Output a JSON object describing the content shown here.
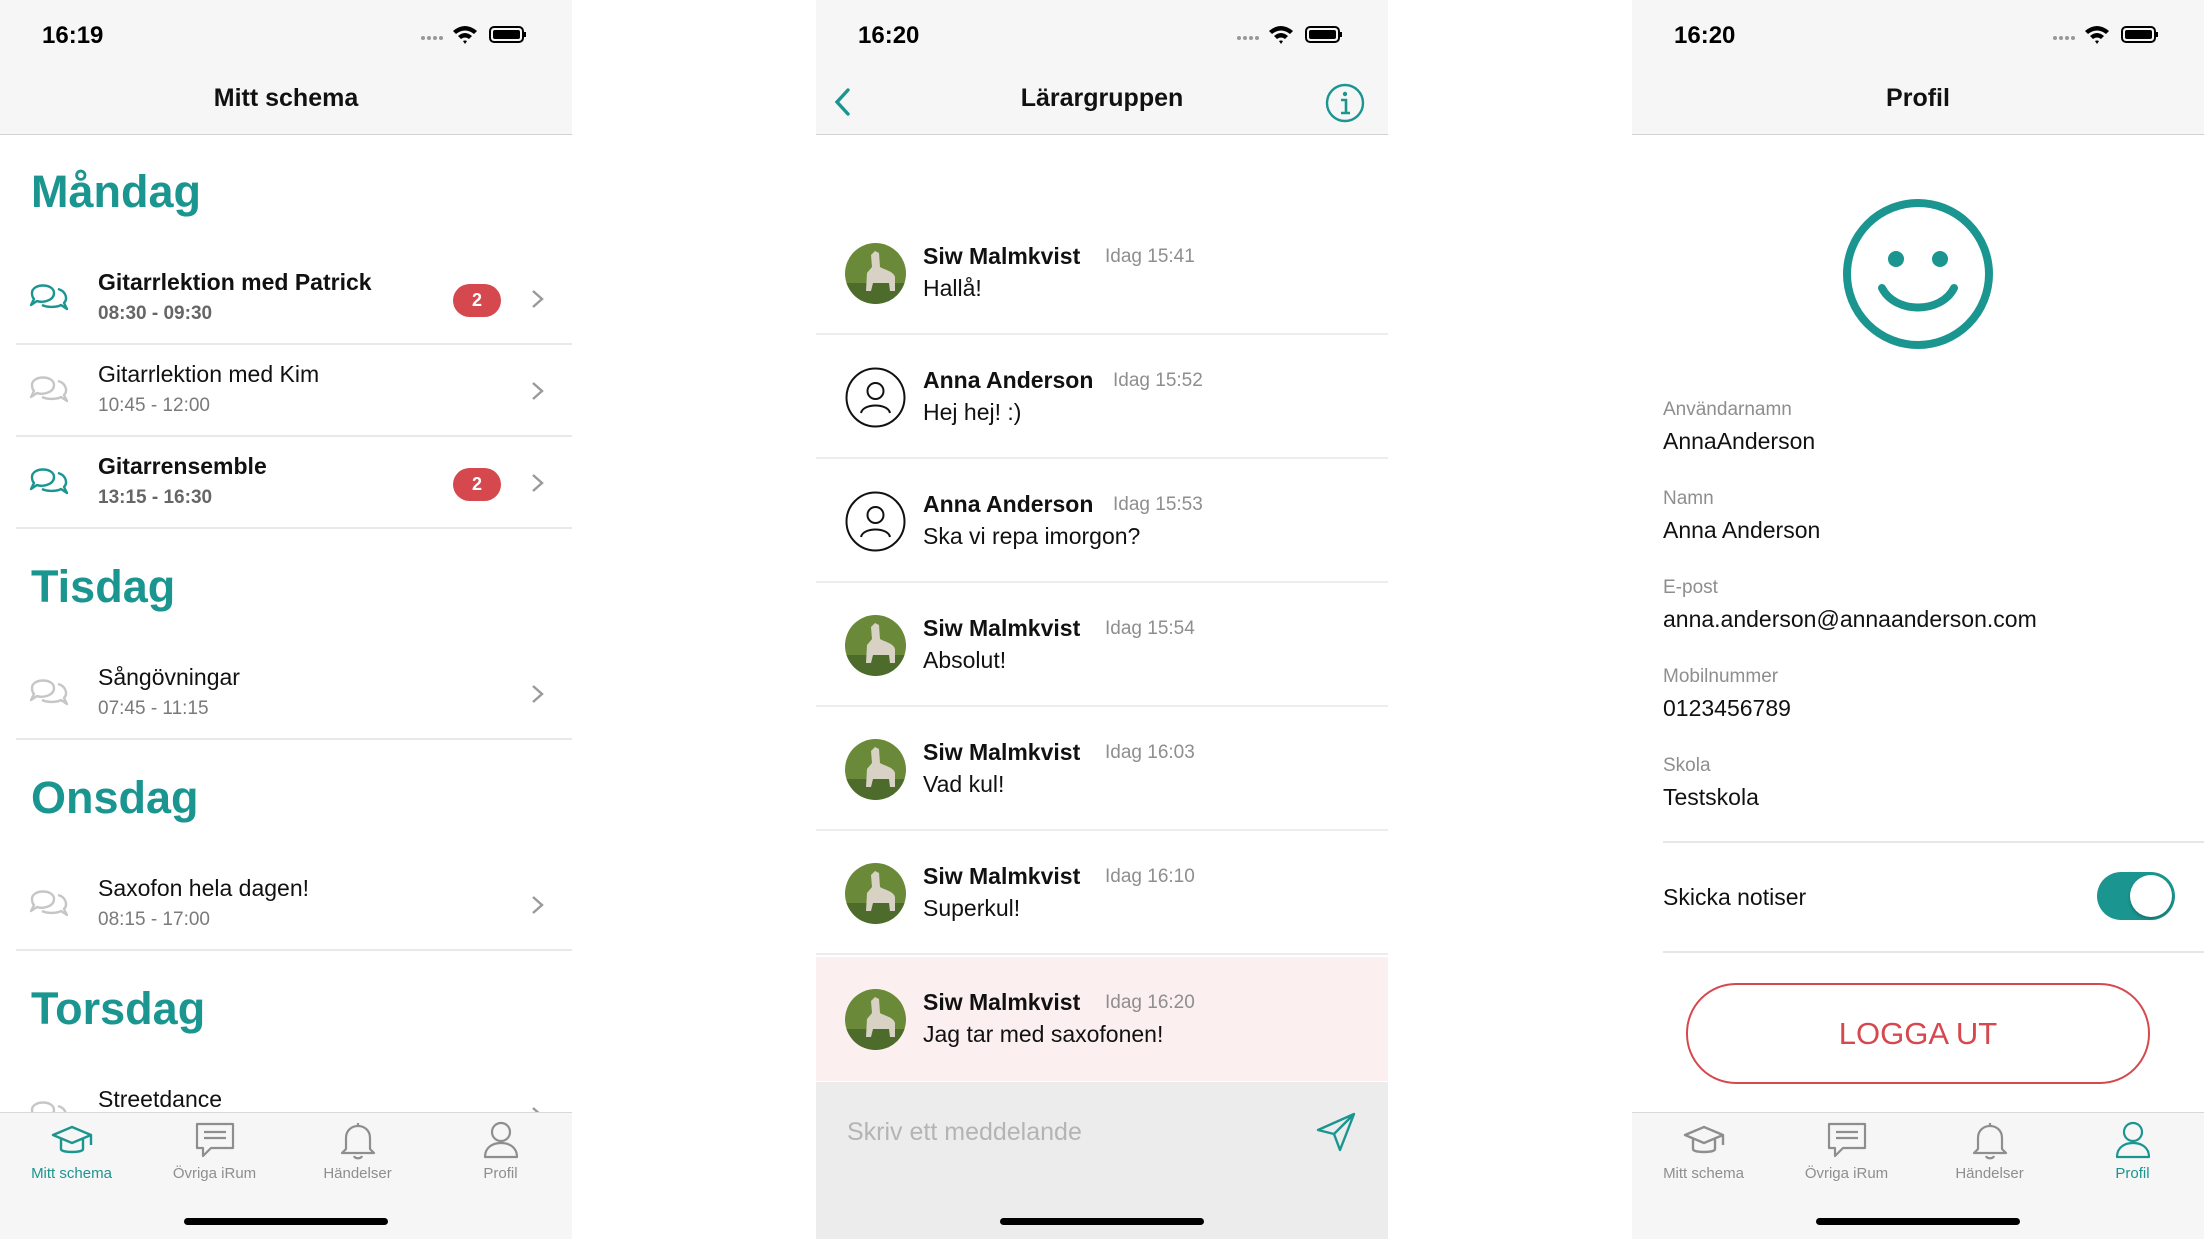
{
  "colors": {
    "accent": "#1b9590",
    "danger": "#d5484e",
    "muted": "#8e8e8e"
  },
  "schedule": {
    "time": "16:19",
    "title": "Mitt schema",
    "days": [
      {
        "name": "Måndag",
        "items": [
          {
            "title": "Gitarrlektion med Patrick",
            "time": "08:30 - 09:30",
            "badge": "2"
          },
          {
            "title": "Gitarrlektion med Kim",
            "time": "10:45 - 12:00"
          },
          {
            "title": "Gitarrensemble",
            "time": "13:15 - 16:30",
            "badge": "2"
          }
        ]
      },
      {
        "name": "Tisdag",
        "items": [
          {
            "title": "Sångövningar",
            "time": "07:45 - 11:15"
          }
        ]
      },
      {
        "name": "Onsdag",
        "items": [
          {
            "title": "Saxofon hela dagen!",
            "time": "08:15 - 17:00"
          }
        ]
      },
      {
        "name": "Torsdag",
        "items": [
          {
            "title": "Streetdance"
          }
        ]
      }
    ]
  },
  "tabs": [
    {
      "label": "Mitt schema",
      "icon": "graduation-cap-icon"
    },
    {
      "label": "Övriga iRum",
      "icon": "chat-bubble-icon"
    },
    {
      "label": "Händelser",
      "icon": "bell-icon"
    },
    {
      "label": "Profil",
      "icon": "person-icon"
    }
  ],
  "chat": {
    "time": "16:20",
    "title": "Lärargruppen",
    "messages": [
      {
        "name": "Siw Malmkvist",
        "time": "Idag 15:41",
        "text": "Hallå!",
        "avatar": "photo"
      },
      {
        "name": "Anna Anderson",
        "time": "Idag 15:52",
        "text": "Hej hej! :)",
        "avatar": "placeholder"
      },
      {
        "name": "Anna Anderson",
        "time": "Idag 15:53",
        "text": "Ska vi repa imorgon?",
        "avatar": "placeholder"
      },
      {
        "name": "Siw Malmkvist",
        "time": "Idag 15:54",
        "text": "Absolut!",
        "avatar": "photo"
      },
      {
        "name": "Siw Malmkvist",
        "time": "Idag 16:03",
        "text": "Vad kul!",
        "avatar": "photo"
      },
      {
        "name": "Siw Malmkvist",
        "time": "Idag 16:10",
        "text": "Superkul!",
        "avatar": "photo"
      },
      {
        "name": "Siw Malmkvist",
        "time": "Idag 16:20",
        "text": "Jag tar med saxofonen!",
        "avatar": "photo",
        "highlighted": true
      }
    ],
    "placeholder": "Skriv ett meddelande"
  },
  "profile": {
    "time": "16:20",
    "title": "Profil",
    "fields": [
      {
        "label": "Användarnamn",
        "value": "AnnaAnderson"
      },
      {
        "label": "Namn",
        "value": "Anna Anderson"
      },
      {
        "label": "E-post",
        "value": "anna.anderson@annaanderson.com"
      },
      {
        "label": "Mobilnummer",
        "value": "0123456789"
      },
      {
        "label": "Skola",
        "value": "Testskola"
      }
    ],
    "notify_label": "Skicka notiser",
    "notify_on": true,
    "logout": "LOGGA UT"
  }
}
